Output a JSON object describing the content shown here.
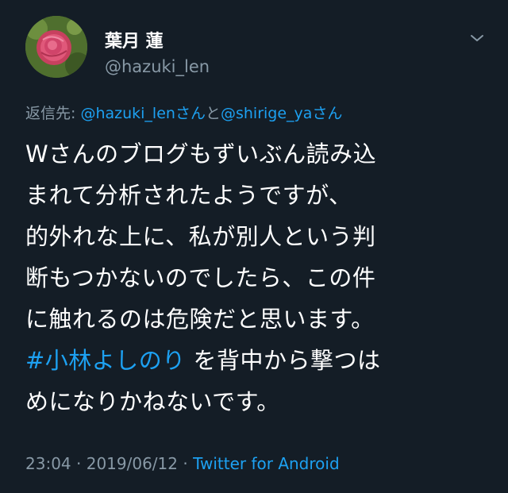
{
  "user": {
    "display_name": "葉月 蓮",
    "handle": "@hazuki_len"
  },
  "reply": {
    "prefix": "返信先: ",
    "mention1": "@hazuki_lenさん",
    "connector": "と",
    "mention2": "@shirige_yaさん"
  },
  "tweet": {
    "lines": [
      "Wさんのブログもずいぶん読み込",
      "まれて分析されたようですが、",
      "的外れな上に、私が別人という判",
      "断もつかないのでしたら、この件",
      "に触れるのは危険だと思います。"
    ],
    "hashtag": "#小林よしのり",
    "line6_rest": " を背中から撃つは",
    "line7": "めになりかねないです。"
  },
  "meta": {
    "time": "23:04",
    "separator": " · ",
    "date": "2019/06/12",
    "source": "Twitter for Android"
  },
  "icons": {
    "avatar": "rose-photo-avatar",
    "menu": "chevron-down-icon"
  },
  "colors": {
    "background": "#141d26",
    "accent": "#1da1f2",
    "muted": "#8899a6"
  }
}
